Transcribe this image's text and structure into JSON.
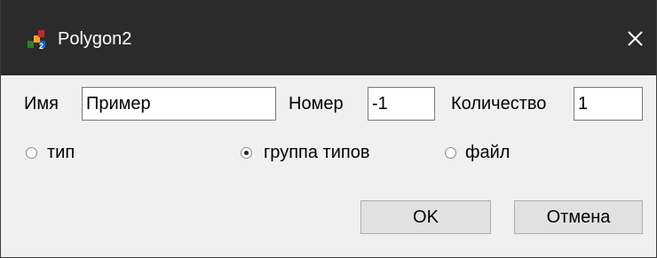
{
  "window": {
    "title": "Polygon2",
    "icon": "polygon-app-icon",
    "close_icon": "close-icon"
  },
  "form": {
    "name_label": "Имя",
    "name_value": "Пример",
    "number_label": "Номер",
    "number_value": "-1",
    "count_label": "Количество",
    "count_value": "1"
  },
  "radios": [
    {
      "label": "тип",
      "checked": false
    },
    {
      "label": "группа типов",
      "checked": true
    },
    {
      "label": "файл",
      "checked": false
    }
  ],
  "buttons": {
    "ok_label": "OK",
    "cancel_label": "Отмена"
  }
}
